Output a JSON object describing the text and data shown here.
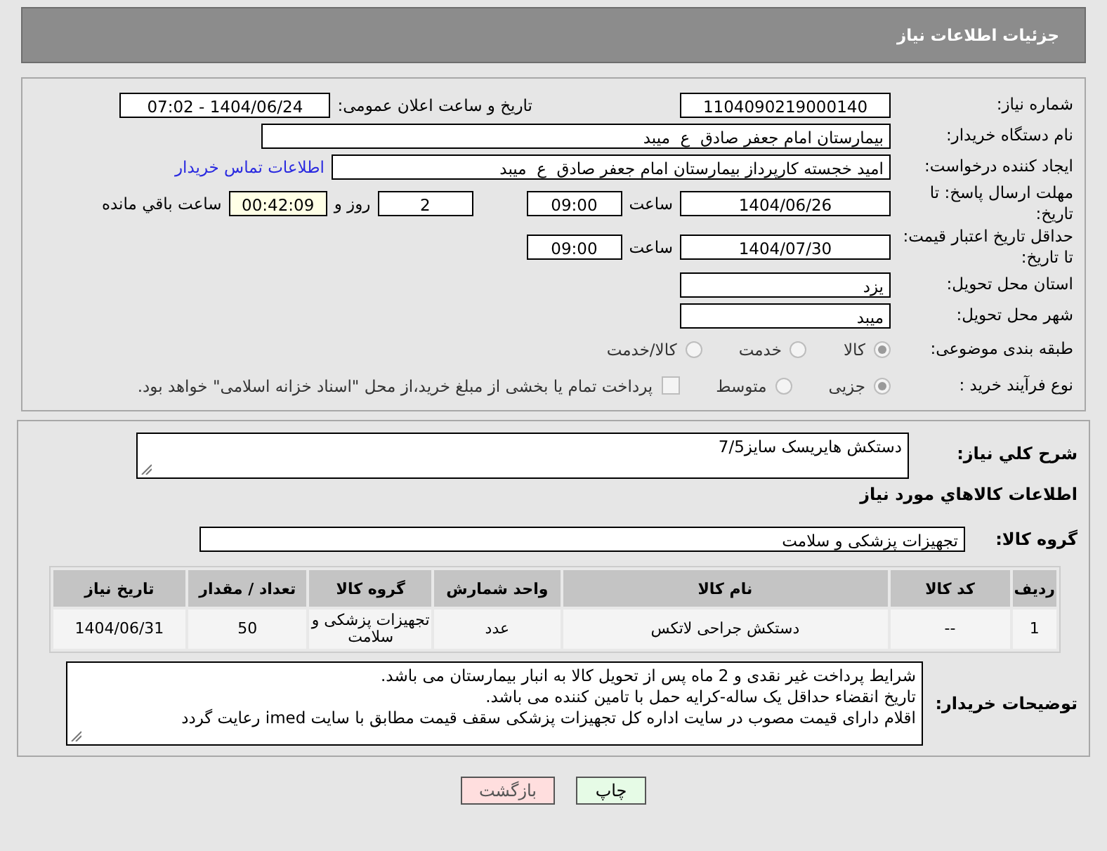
{
  "header": {
    "title": "جزئیات اطلاعات نیاز"
  },
  "form": {
    "need_number": {
      "label": "شماره نیاز:",
      "value": "1104090219000140"
    },
    "announce": {
      "label": "تاریخ و ساعت اعلان عمومی:",
      "value": "1404/06/24 - 07:02"
    },
    "buyer_org": {
      "label": "نام دستگاه خریدار:",
      "value": "بیمارستان امام جعفر صادق  ع  میبد"
    },
    "requester": {
      "label": "ایجاد کننده درخواست:",
      "value": "امید خجسته کارپرداز بیمارستان امام جعفر صادق  ع  میبد",
      "link": "اطلاعات تماس خریدار"
    },
    "response_deadline": {
      "label": "مهلت ارسال پاسخ: تا تاریخ:",
      "date": "1404/06/26",
      "time_label": "ساعت",
      "time": "09:00",
      "days": "2",
      "days_label": "روز و",
      "remaining": "00:42:09",
      "remaining_label": "ساعت باقي مانده"
    },
    "price_validity": {
      "label": "حداقل تاریخ اعتبار قیمت: تا تاریخ:",
      "date": "1404/07/30",
      "time_label": "ساعت",
      "time": "09:00"
    },
    "province": {
      "label": "استان محل تحویل:",
      "value": "یزد"
    },
    "city": {
      "label": "شهر محل تحویل:",
      "value": "میبد"
    },
    "category": {
      "label": "طبقه بندی موضوعی:",
      "options": [
        {
          "label": "کالا",
          "selected": true
        },
        {
          "label": "خدمت",
          "selected": false
        },
        {
          "label": "کالا/خدمت",
          "selected": false
        }
      ]
    },
    "process": {
      "label": "نوع فرآیند خرید :",
      "options": [
        {
          "label": "جزیی",
          "selected": true
        },
        {
          "label": "متوسط",
          "selected": false
        }
      ],
      "payment_option": {
        "label": "پرداخت تمام یا بخشی از مبلغ خرید،از محل \"اسناد خزانه اسلامی\" خواهد بود.",
        "checked": false
      }
    }
  },
  "details": {
    "description": {
      "label": "شرح کلي نیاز:",
      "value": "دستکش هایریسک سایز7/5"
    },
    "goods_heading": "اطلاعات کالاهاي مورد نیاز",
    "goods_group": {
      "label": "گروه کالا:",
      "value": "تجهیزات پزشکی و سلامت"
    },
    "table": {
      "columns": [
        "ردیف",
        "کد کالا",
        "نام کالا",
        "واحد شمارش",
        "گروه کالا",
        "تعداد / مقدار",
        "تاریخ نیاز"
      ],
      "rows": [
        [
          "1",
          "--",
          "دستکش جراحی لاتکس",
          "عدد",
          "تجهیزات پزشکی و سلامت",
          "50",
          "1404/06/31"
        ]
      ]
    },
    "buyer_notes": {
      "label": "توضیحات خریدار:",
      "lines": [
        "شرایط پرداخت غیر نقدی و 2 ماه  پس از تحویل کالا به انبار بیمارستان می باشد.",
        "تاریخ انقضاء حداقل یک ساله-کرایه حمل با تامین کننده می باشد.",
        "اقلام دارای قیمت مصوب در سایت اداره کل تجهیزات پزشکی سقف قیمت مطابق با سایت imed  رعایت گردد"
      ]
    }
  },
  "buttons": [
    {
      "kind": "print",
      "label": "چاپ"
    },
    {
      "kind": "back",
      "label": "بازگشت"
    }
  ]
}
